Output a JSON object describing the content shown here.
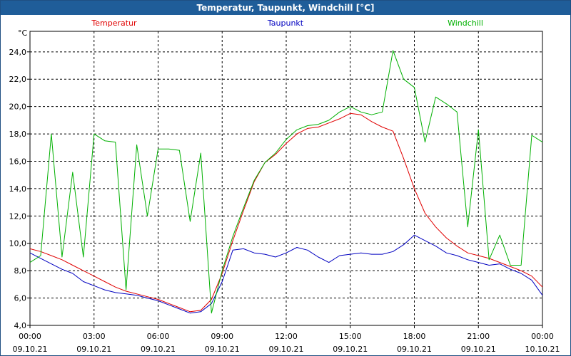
{
  "window": {
    "title": "Temperatur, Taupunkt, Windchill [°C]"
  },
  "chart_data": {
    "type": "line",
    "title": "Temperatur, Taupunkt, Windchill [°C]",
    "ylabel": "°C",
    "ylim": [
      4.0,
      25.5
    ],
    "yticks": [
      "4,0",
      "6,0",
      "8,0",
      "10,0",
      "12,0",
      "14,0",
      "16,0",
      "18,0",
      "20,0",
      "22,0",
      "24,0"
    ],
    "xlim_hours": [
      0,
      24
    ],
    "xticks": [
      {
        "time": "00:00",
        "date": "09.10.21"
      },
      {
        "time": "03:00",
        "date": "09.10.21"
      },
      {
        "time": "06:00",
        "date": "09.10.21"
      },
      {
        "time": "09:00",
        "date": "09.10.21"
      },
      {
        "time": "12:00",
        "date": "09.10.21"
      },
      {
        "time": "15:00",
        "date": "09.10.21"
      },
      {
        "time": "18:00",
        "date": "09.10.21"
      },
      {
        "time": "21:00",
        "date": "09.10.21"
      },
      {
        "time": "00:00",
        "date": "10.10.21"
      }
    ],
    "grid": true,
    "x_hours": [
      0,
      0.5,
      1,
      1.5,
      2,
      2.5,
      3,
      3.5,
      4,
      4.5,
      5,
      5.5,
      6,
      6.5,
      7,
      7.5,
      8,
      8.5,
      9,
      9.5,
      10,
      10.5,
      11,
      11.5,
      12,
      12.5,
      13,
      13.5,
      14,
      14.5,
      15,
      15.5,
      16,
      16.5,
      17,
      17.5,
      18,
      18.5,
      19,
      19.5,
      20,
      20.5,
      21,
      21.5,
      22,
      22.5,
      23,
      23.5,
      24
    ],
    "series": [
      {
        "name": "Temperatur",
        "color": "#e00000",
        "values": [
          9.6,
          9.4,
          9.1,
          8.8,
          8.4,
          8.0,
          7.6,
          7.2,
          6.8,
          6.5,
          6.3,
          6.1,
          5.9,
          5.6,
          5.3,
          5.0,
          5.1,
          5.9,
          7.8,
          10.2,
          12.4,
          14.5,
          15.9,
          16.5,
          17.3,
          18.0,
          18.4,
          18.5,
          18.8,
          19.1,
          19.5,
          19.4,
          18.9,
          18.5,
          18.2,
          16.2,
          14.0,
          12.2,
          11.2,
          10.4,
          9.8,
          9.3,
          9.1,
          8.9,
          8.6,
          8.3,
          8.0,
          7.6,
          6.8
        ]
      },
      {
        "name": "Taupunkt",
        "color": "#0000c0",
        "values": [
          9.3,
          8.9,
          8.5,
          8.1,
          7.8,
          7.2,
          6.9,
          6.6,
          6.4,
          6.3,
          6.2,
          6.0,
          5.8,
          5.5,
          5.2,
          4.9,
          5.0,
          5.6,
          7.2,
          9.5,
          9.6,
          9.3,
          9.2,
          9.0,
          9.3,
          9.7,
          9.5,
          9.0,
          8.6,
          9.1,
          9.2,
          9.3,
          9.2,
          9.2,
          9.4,
          9.9,
          10.6,
          10.2,
          9.8,
          9.3,
          9.1,
          8.8,
          8.6,
          8.4,
          8.5,
          8.1,
          7.8,
          7.3,
          6.2
        ]
      },
      {
        "name": "Windchill",
        "color": "#00b000",
        "values": [
          8.6,
          9.1,
          18.0,
          9.0,
          15.2,
          9.0,
          18.0,
          17.5,
          17.4,
          6.6,
          17.2,
          12.0,
          16.9,
          16.9,
          16.8,
          11.6,
          16.6,
          4.9,
          8.0,
          10.5,
          12.6,
          14.6,
          15.9,
          16.6,
          17.6,
          18.3,
          18.6,
          18.7,
          19.0,
          19.6,
          20.0,
          19.6,
          19.4,
          19.6,
          24.1,
          22.0,
          21.4,
          17.4,
          20.7,
          20.2,
          19.6,
          11.2,
          18.3,
          8.8,
          10.6,
          8.4,
          8.4,
          17.9,
          17.4
        ]
      }
    ]
  }
}
